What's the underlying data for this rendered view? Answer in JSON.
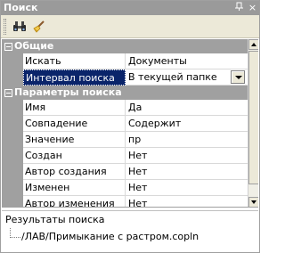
{
  "window": {
    "title": "Поиск"
  },
  "groups": [
    {
      "label": "Общие",
      "rows": [
        {
          "name": "Искать",
          "value": "Документы"
        },
        {
          "name": "Интервал поиска",
          "value": "В текущей папке",
          "selected": true
        }
      ]
    },
    {
      "label": "Параметры поиска",
      "rows": [
        {
          "name": "Имя",
          "value": "Да"
        },
        {
          "name": "Совпадение",
          "value": "Содержит"
        },
        {
          "name": "Значение",
          "value": "пр"
        },
        {
          "name": "Создан",
          "value": "Нет"
        },
        {
          "name": "Автор создания",
          "value": "Нет"
        },
        {
          "name": "Изменен",
          "value": "Нет"
        },
        {
          "name": "Автор изменения",
          "value": "Нет"
        }
      ]
    }
  ],
  "results": {
    "header": "Результаты поиска",
    "items": [
      "/ЛАВ/Примыкание с растром.copln"
    ]
  },
  "icons": {
    "find": "binoculars-icon",
    "clear": "broom-icon",
    "pin": "pin-icon",
    "close": "close-icon"
  },
  "colors": {
    "titlebar": "#9a9a9a",
    "group_header": "#a0a0a0",
    "selection": "#0a246a",
    "toolbar": "#ece9d8"
  }
}
